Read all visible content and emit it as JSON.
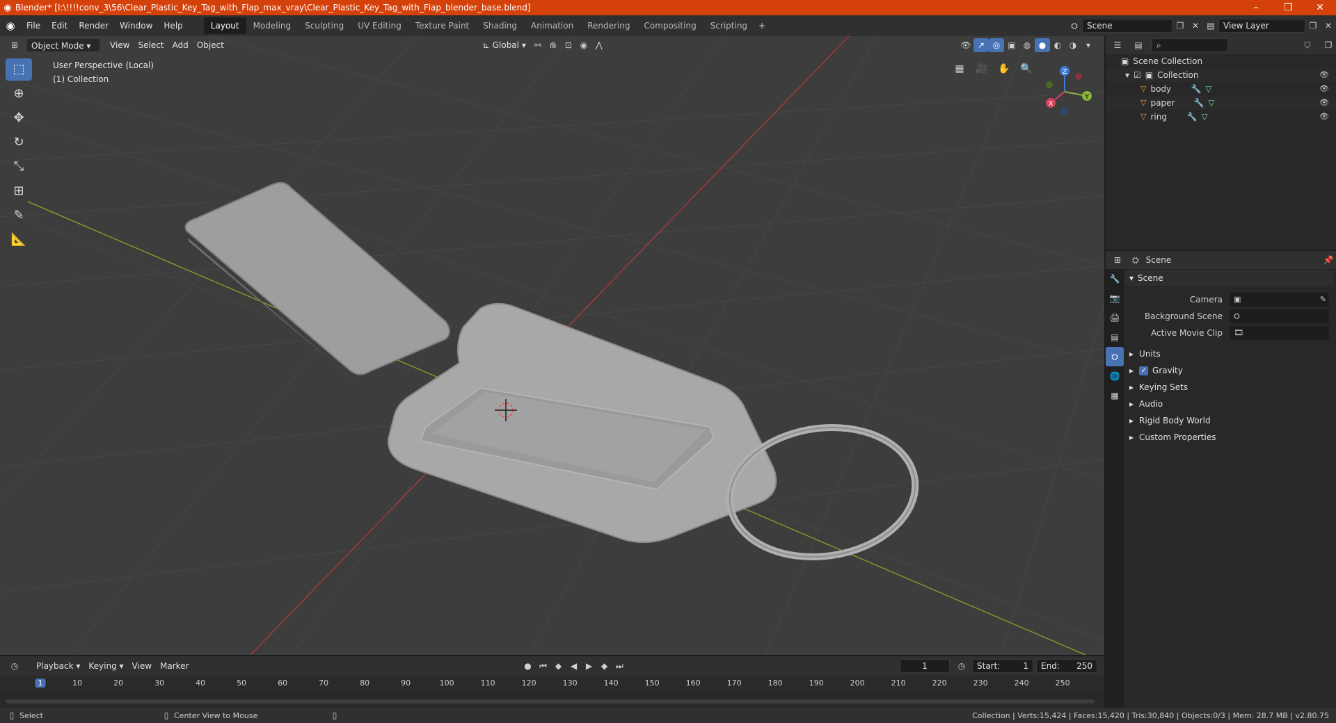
{
  "window": {
    "title": "Blender* [I:\\!!!!conv_3\\56\\Clear_Plastic_Key_Tag_with_Flap_max_vray\\Clear_Plastic_Key_Tag_with_Flap_blender_base.blend]"
  },
  "menu": {
    "items": [
      "File",
      "Edit",
      "Render",
      "Window",
      "Help"
    ]
  },
  "workspaces": {
    "tabs": [
      "Layout",
      "Modeling",
      "Sculpting",
      "UV Editing",
      "Texture Paint",
      "Shading",
      "Animation",
      "Rendering",
      "Compositing",
      "Scripting"
    ],
    "active": "Layout"
  },
  "scene_selector": {
    "value": "Scene"
  },
  "view_layer_selector": {
    "value": "View Layer"
  },
  "viewport": {
    "mode": "Object Mode",
    "menus": [
      "View",
      "Select",
      "Add",
      "Object"
    ],
    "orientation": "Global",
    "perspective": "User Perspective (Local)",
    "collection": "(1) Collection",
    "gizmo_labels": {
      "x": "X",
      "y": "Y",
      "z": "Z"
    }
  },
  "outliner": {
    "root": "Scene Collection",
    "collection": "Collection",
    "objects": [
      "body",
      "paper",
      "ring"
    ]
  },
  "properties": {
    "header": "Scene",
    "section": "Scene",
    "fields": [
      {
        "label": "Camera"
      },
      {
        "label": "Background Scene"
      },
      {
        "label": "Active Movie Clip"
      }
    ],
    "subpanels": [
      "Units",
      "Gravity",
      "Keying Sets",
      "Audio",
      "Rigid Body World",
      "Custom Properties"
    ]
  },
  "timeline": {
    "menus": [
      "Playback",
      "Keying",
      "View",
      "Marker"
    ],
    "current_frame": "1",
    "start_label": "Start:",
    "start": "1",
    "end_label": "End:",
    "end": "250",
    "ruler": [
      "1",
      "10",
      "20",
      "30",
      "40",
      "50",
      "60",
      "70",
      "80",
      "90",
      "100",
      "110",
      "120",
      "130",
      "140",
      "150",
      "160",
      "170",
      "180",
      "190",
      "200",
      "210",
      "220",
      "230",
      "240",
      "250"
    ]
  },
  "status": {
    "select": "Select",
    "center_view": "Center View to Mouse",
    "stats": "Collection | Verts:15,424 | Faces:15,420 | Tris:30,840 | Objects:0/3 | Mem: 28.7 MB | v2.80.75"
  }
}
